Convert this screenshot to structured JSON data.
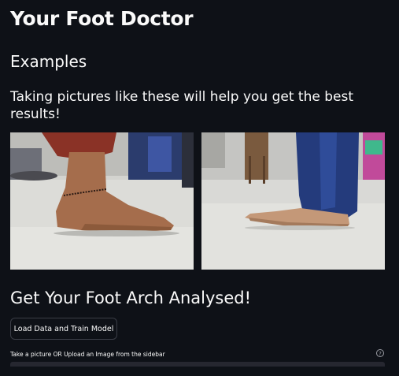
{
  "header": {
    "title": "Your Foot Doctor"
  },
  "examples": {
    "heading": "Examples",
    "subtitle": "Taking pictures like these will help you get the best results!",
    "images": [
      {
        "alt": "Side view of a foot with an anklet standing on a tiled floor"
      },
      {
        "alt": "Side view of a bare foot standing on a tiled floor next to trousers"
      }
    ]
  },
  "analysis": {
    "heading": "Get Your Foot Arch Analysed!",
    "button_label": "Load Data and Train Model",
    "camera_label": "Take a picture OR Upload an Image from the sidebar",
    "help_icon": "?"
  },
  "colors": {
    "background": "#0e1117",
    "text": "#fafafa",
    "button_border": "#3a3d46",
    "widget_bg": "#262730"
  }
}
